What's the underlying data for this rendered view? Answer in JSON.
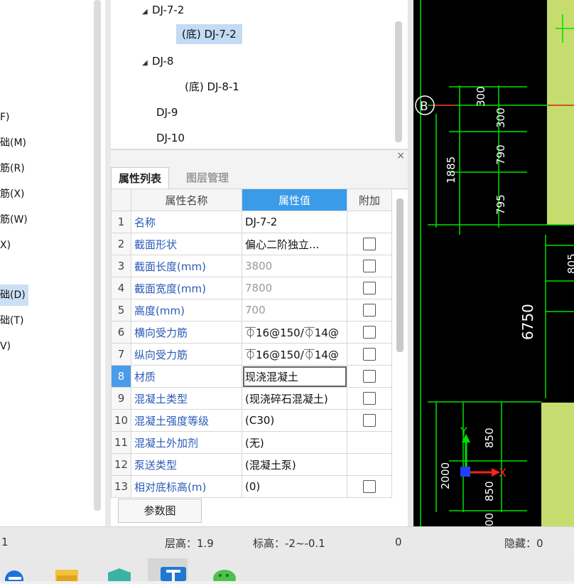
{
  "left_menu": [
    "F)",
    "础(M)",
    "筋(R)",
    "筋(X)",
    "筋(W)",
    "X)",
    "础(D)",
    "础(T)",
    "V)"
  ],
  "tree": {
    "nodes": [
      {
        "label": "DJ-7-2",
        "expanded": true
      },
      {
        "label": "(底) DJ-7-2",
        "selected": true
      },
      {
        "label": "DJ-8",
        "expanded": true
      },
      {
        "label": "(底) DJ-8-1"
      },
      {
        "label": "DJ-9"
      },
      {
        "label": "DJ-10"
      }
    ]
  },
  "panel": {
    "close": "×",
    "tabs": [
      "属性列表",
      "图层管理"
    ],
    "headers": [
      "属性名称",
      "属性值",
      "附加"
    ],
    "rows": [
      {
        "n": "1",
        "name": "名称",
        "value": "DJ-7-2",
        "check": false
      },
      {
        "n": "2",
        "name": "截面形状",
        "value": "偏心二阶独立...",
        "check": true
      },
      {
        "n": "3",
        "name": "截面长度(mm)",
        "value": "3800",
        "check": true
      },
      {
        "n": "4",
        "name": "截面宽度(mm)",
        "value": "7800",
        "check": true
      },
      {
        "n": "5",
        "name": "高度(mm)",
        "value": "700",
        "check": true
      },
      {
        "n": "6",
        "name": "横向受力筋",
        "value": "⏁16@150/⏁14@",
        "check": true
      },
      {
        "n": "7",
        "name": "纵向受力筋",
        "value": "⏁16@150/⏁14@",
        "check": true
      },
      {
        "n": "8",
        "name": "材质",
        "value": "现浇混凝土",
        "check": true
      },
      {
        "n": "9",
        "name": "混凝土类型",
        "value": "(现浇碎石混凝土)",
        "check": true
      },
      {
        "n": "10",
        "name": "混凝土强度等级",
        "value": "(C30)",
        "check": true
      },
      {
        "n": "11",
        "name": "混凝土外加剂",
        "value": "(无)",
        "check": false
      },
      {
        "n": "12",
        "name": "泵送类型",
        "value": "(混凝土泵)",
        "check": false
      },
      {
        "n": "13",
        "name": "相对底标高(m)",
        "value": "(0)",
        "check": true
      }
    ],
    "param_button": "参数图"
  },
  "cad": {
    "axis_b": "B",
    "dims_left": [
      "300",
      "300",
      "790",
      "1885",
      "795"
    ],
    "dim_805": "805",
    "dim_6750": "6750",
    "dims_bottom": [
      "850",
      "2000",
      "850",
      "00"
    ],
    "axis_y": "Y",
    "axis_x": "X",
    "colors": {
      "bg": "#000000",
      "green": "#00e000",
      "fill": "#c6dc6e",
      "red": "#ff2020",
      "blue": "#2040ff"
    }
  },
  "status": {
    "left": "1",
    "floor_height": "层高：1.9",
    "elevation": "标高：-2~-0.1",
    "count": "0",
    "hidden": "隐藏：0"
  },
  "taskbar": {
    "icons": [
      "edge-icon",
      "file-explorer-icon",
      "app-cube-icon",
      "app-t-icon",
      "wechat-icon"
    ]
  }
}
